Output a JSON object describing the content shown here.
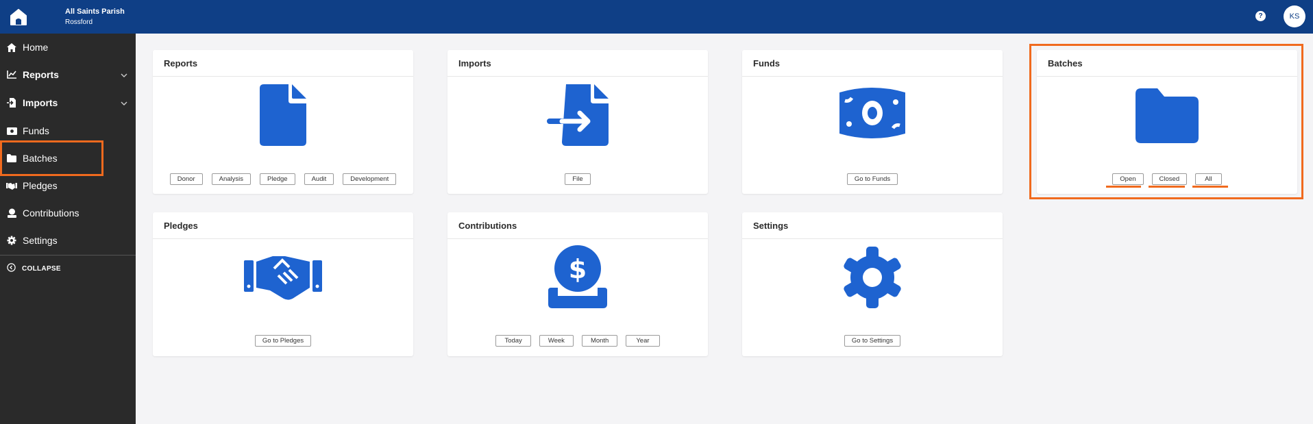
{
  "header": {
    "org_name": "All Saints Parish",
    "org_location": "Rossford",
    "help_label": "?",
    "avatar_initials": "KS",
    "bar_color": "#0f3f86"
  },
  "sidebar": {
    "items": [
      {
        "label": "Home",
        "icon": "home-icon"
      },
      {
        "label": "Reports",
        "icon": "chart-line-icon",
        "expandable": true
      },
      {
        "label": "Imports",
        "icon": "file-import-icon",
        "expandable": true
      },
      {
        "label": "Funds",
        "icon": "money-bill-icon"
      },
      {
        "label": "Batches",
        "icon": "folder-icon",
        "highlighted": true
      },
      {
        "label": "Pledges",
        "icon": "handshake-icon"
      },
      {
        "label": "Contributions",
        "icon": "donate-icon"
      },
      {
        "label": "Settings",
        "icon": "cog-icon"
      }
    ],
    "collapse_label": "COLLAPSE"
  },
  "cards": {
    "reports": {
      "title": "Reports",
      "icon": "file-icon",
      "buttons": [
        "Donor",
        "Analysis",
        "Pledge",
        "Audit",
        "Development"
      ]
    },
    "imports": {
      "title": "Imports",
      "icon": "file-import-icon",
      "buttons": [
        "File"
      ]
    },
    "funds": {
      "title": "Funds",
      "icon": "money-bill-icon",
      "buttons": [
        "Go to Funds"
      ]
    },
    "batches": {
      "title": "Batches",
      "icon": "folder-icon",
      "buttons": [
        "Open",
        "Closed",
        "All"
      ],
      "highlighted": true
    },
    "pledges": {
      "title": "Pledges",
      "icon": "handshake-icon",
      "buttons": [
        "Go to Pledges"
      ]
    },
    "contributions": {
      "title": "Contributions",
      "icon": "donate-icon",
      "buttons": [
        "Today",
        "Week",
        "Month",
        "Year"
      ]
    },
    "settings": {
      "title": "Settings",
      "icon": "cog-icon",
      "buttons": [
        "Go to Settings"
      ]
    }
  },
  "colors": {
    "icon_blue": "#1e63d0",
    "highlight": "#f06a1e",
    "sidebar_bg": "#2a2a2a"
  }
}
